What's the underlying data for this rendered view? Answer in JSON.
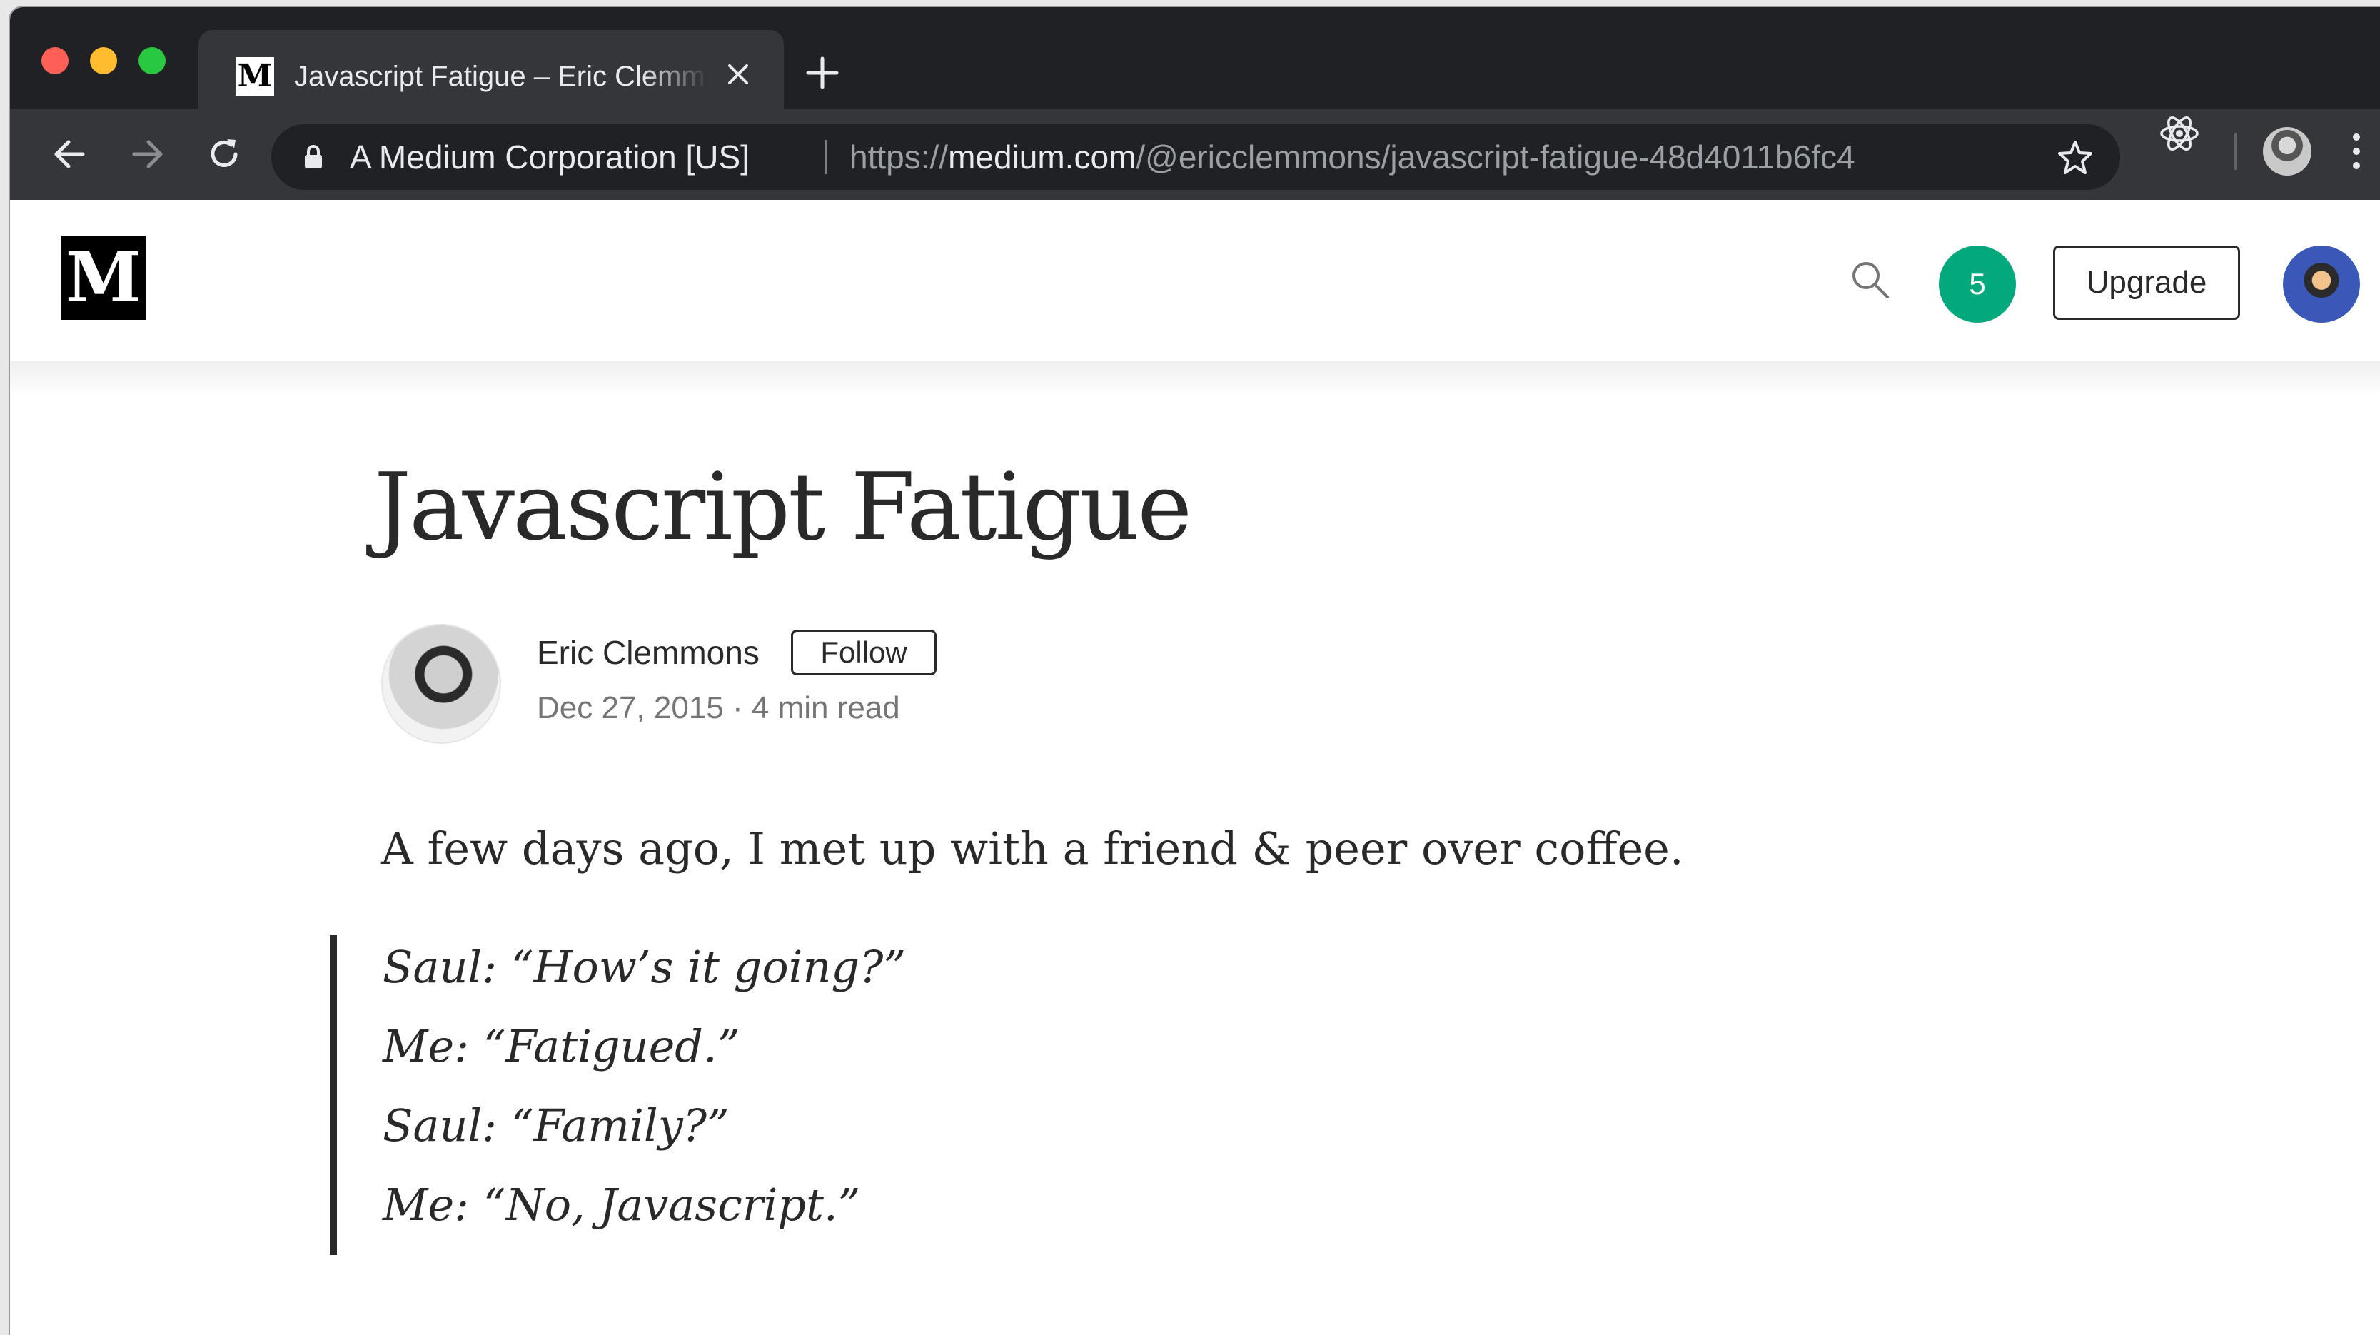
{
  "browser": {
    "tab": {
      "favicon_text": "M",
      "title": "Javascript Fatigue – Eric Clemmons"
    },
    "toolbar": {
      "site_identity": "A Medium Corporation [US]",
      "url_scheme": "https://",
      "url_host": "medium.com",
      "url_path": "/@ericclemmons/javascript-fatigue-48d4011b6fc4"
    },
    "colors": {
      "tabstrip": "#202124",
      "toolbar": "#35363a",
      "close": "#fe5f57",
      "minimize": "#febc2e",
      "maximize": "#28c840"
    }
  },
  "medium": {
    "logo_text": "M",
    "notifications_count": "5",
    "upgrade_label": "Upgrade",
    "accent": "#03a87c"
  },
  "article": {
    "title": "Javascript Fatigue",
    "author_name": "Eric Clemmons",
    "follow_label": "Follow",
    "date": "Dec 27, 2015",
    "separator": "·",
    "read_time": "4 min read",
    "lead": "A few days ago, I met up with a friend & peer over coffee.",
    "quote_lines": [
      "Saul: “How’s it going?”",
      "Me: “Fatigued.”",
      "Saul: “Family?”",
      "Me: “No, Javascript.”"
    ]
  }
}
